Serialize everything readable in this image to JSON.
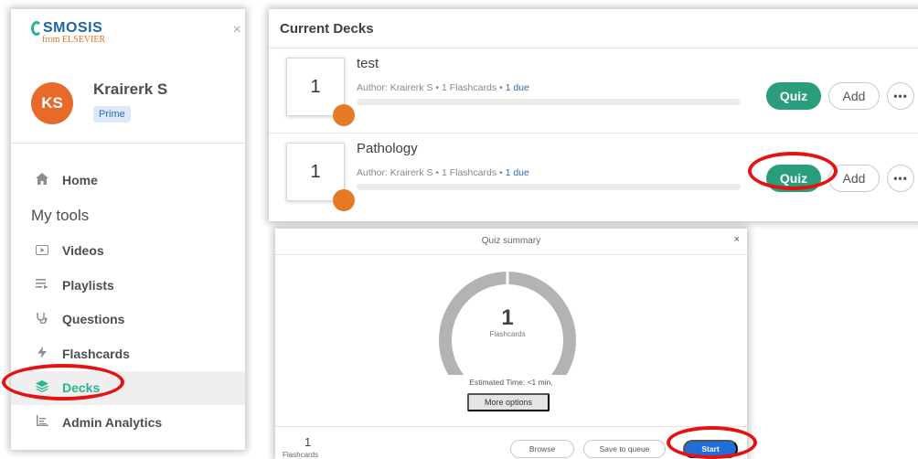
{
  "sidebar": {
    "close_glyph": "×",
    "logo": {
      "name": "SMOSIS",
      "sub": "from ELSEVIER"
    },
    "user": {
      "initials": "KS",
      "name": "Krairerk S",
      "plan": "Prime"
    },
    "nav": {
      "home": {
        "label": "Home",
        "icon": "home-icon"
      },
      "section_heading": "My tools",
      "videos": {
        "label": "Videos",
        "icon": "video-icon"
      },
      "playlists": {
        "label": "Playlists",
        "icon": "playlist-icon"
      },
      "questions": {
        "label": "Questions",
        "icon": "stethoscope-icon"
      },
      "flashcards": {
        "label": "Flashcards",
        "icon": "lightning-icon"
      },
      "decks": {
        "label": "Decks",
        "icon": "layers-icon",
        "active": true
      },
      "admin_analytics": {
        "label": "Admin Analytics",
        "icon": "analytics-icon"
      }
    }
  },
  "decks_panel": {
    "title": "Current Decks",
    "rows": [
      {
        "count": "1",
        "name": "test",
        "meta_prefix": "Author: Krairerk S • 1 Flashcards • ",
        "meta_due": "1 due",
        "quiz_label": "Quiz",
        "add_label": "Add",
        "more_glyph": "•••"
      },
      {
        "count": "1",
        "name": "Pathology",
        "meta_prefix": "Author: Krairerk S • 1 Flashcards • ",
        "meta_due": "1 due",
        "quiz_label": "Quiz",
        "add_label": "Add",
        "more_glyph": "•••"
      }
    ]
  },
  "quiz_summary": {
    "title": "Quiz summary",
    "close_glyph": "×",
    "count": "1",
    "count_label": "Flashcards",
    "estimated_time": "Estimated Time: <1 min.",
    "more_options_label": "More options",
    "footer": {
      "count": "1",
      "count_label": "Flashcards",
      "browse_label": "Browse",
      "save_label": "Save to queue",
      "start_label": "Start"
    }
  },
  "colors": {
    "brand_green": "#2a9d7c",
    "accent_blue": "#1e6fd9",
    "annotation_red": "#e41212",
    "avatar_orange": "#e76a2a"
  }
}
